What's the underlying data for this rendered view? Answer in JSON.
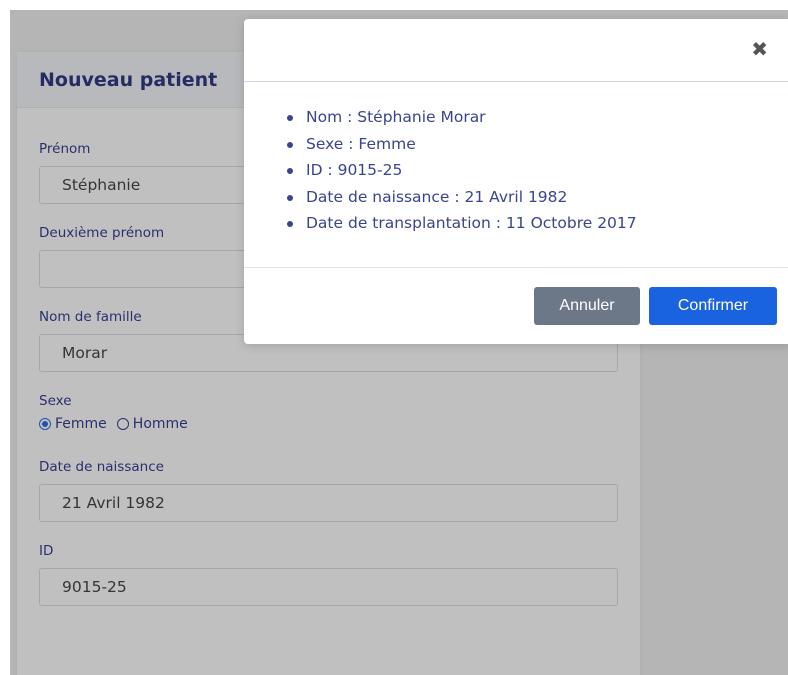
{
  "form": {
    "title": "Nouveau patient",
    "fields": {
      "first_name": {
        "label": "Prénom",
        "value": "Stéphanie"
      },
      "middle_name": {
        "label": "Deuxième prénom",
        "value": ""
      },
      "last_name": {
        "label": "Nom de famille",
        "value": "Morar"
      },
      "sex": {
        "label": "Sexe",
        "options": [
          "Femme",
          "Homme"
        ],
        "selected": "Femme"
      },
      "birth_date": {
        "label": "Date de naissance",
        "value": "21 Avril 1982"
      },
      "id": {
        "label": "ID",
        "value": "9015-25"
      }
    }
  },
  "modal": {
    "close_icon": "close-icon",
    "items": [
      "Nom : Stéphanie Morar",
      "Sexe : Femme",
      "ID : 9015-25",
      "Date de naissance : 21 Avril 1982",
      "Date de transplantation : 11 Octobre 2017"
    ],
    "cancel_label": "Annuler",
    "confirm_label": "Confirmer"
  },
  "colors": {
    "accent": "#1a63e0",
    "label": "#232a86",
    "cancel": "#6c7887"
  }
}
